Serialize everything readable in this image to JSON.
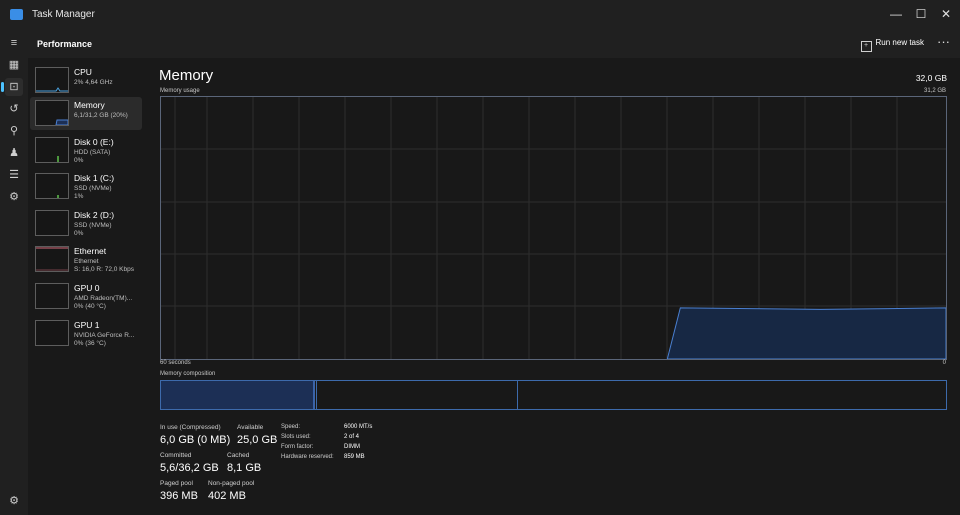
{
  "window": {
    "title": "Task Manager",
    "controls": {
      "minimize": "—",
      "maximize": "☐",
      "close": "✕"
    }
  },
  "nav": [
    "hamburger-icon",
    "processes-icon",
    "performance-icon",
    "app-history-icon",
    "startup-apps-icon",
    "users-icon",
    "details-icon",
    "services-icon",
    "settings-icon"
  ],
  "header": {
    "title": "Performance",
    "run_new_task": "Run new task",
    "more": "···"
  },
  "sidebar": {
    "items": [
      {
        "name": "CPU",
        "sub1": "2% 4,64 GHz",
        "sub2": "",
        "color": "#4aa3e0"
      },
      {
        "name": "Memory",
        "sub1": "6,1/31,2 GB (20%)",
        "sub2": "",
        "color": "#3d7fd6"
      },
      {
        "name": "Disk 0 (E:)",
        "sub1": "HDD (SATA)",
        "sub2": "0%",
        "color": "#5ec24b"
      },
      {
        "name": "Disk 1 (C:)",
        "sub1": "SSD (NVMe)",
        "sub2": "1%",
        "color": "#5ec24b"
      },
      {
        "name": "Disk 2 (D:)",
        "sub1": "SSD (NVMe)",
        "sub2": "0%",
        "color": "#5ec24b"
      },
      {
        "name": "Ethernet",
        "sub1": "Ethernet",
        "sub2": "S: 16,0 R: 72,0 Kbps",
        "color": "#d66a7a"
      },
      {
        "name": "GPU 0",
        "sub1": "AMD Radeon(TM)...",
        "sub2": "0% (40 °C)",
        "color": "#7a5fd6"
      },
      {
        "name": "GPU 1",
        "sub1": "NVIDIA GeForce R...",
        "sub2": "0% (36 °C)",
        "color": "#7a5fd6"
      }
    ]
  },
  "memory": {
    "title": "Memory",
    "total": "32,0 GB",
    "usage_label": "Memory usage",
    "usage_max": "31,2 GB",
    "axis_left": "60 seconds",
    "axis_right": "0",
    "composition_label": "Memory composition",
    "graph_color": "#4a7fd0",
    "usage_fraction": 0.195,
    "stats": {
      "in_use_label": "In use (Compressed)",
      "in_use_value": "6,0 GB (0 MB)",
      "available_label": "Available",
      "available_value": "25,0 GB",
      "committed_label": "Committed",
      "committed_value": "5,6/36,2 GB",
      "cached_label": "Cached",
      "cached_value": "8,1 GB",
      "paged_label": "Paged pool",
      "paged_value": "396 MB",
      "nonpaged_label": "Non-paged pool",
      "nonpaged_value": "402 MB"
    },
    "hardware": {
      "speed_label": "Speed:",
      "speed_value": "6000 MT/s",
      "slots_label": "Slots used:",
      "slots_value": "2 of 4",
      "form_label": "Form factor:",
      "form_value": "DIMM",
      "reserved_label": "Hardware reserved:",
      "reserved_value": "859 MB"
    }
  }
}
